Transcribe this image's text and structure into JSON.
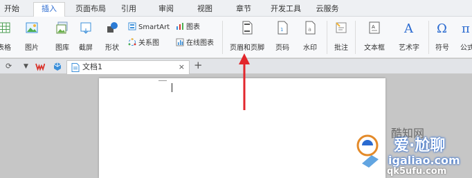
{
  "menu": {
    "tabs": [
      "开始",
      "插入",
      "页面布局",
      "引用",
      "审阅",
      "视图",
      "章节",
      "开发工具",
      "云服务"
    ],
    "active": "插入"
  },
  "ribbon": {
    "table_label": "表格",
    "picture_label": "图片",
    "gallery_label": "图库",
    "screenshot_label": "截屏",
    "shape_label": "形状",
    "smartart_label": "SmartArt",
    "chart_label": "图表",
    "relation_label": "关系图",
    "online_chart_label": "在线图表",
    "header_footer_label": "页眉和页脚",
    "page_number_label": "页码",
    "watermark_label": "水印",
    "comment_label": "批注",
    "textbox_label": "文本框",
    "wordart_label": "艺术字",
    "symbol_label": "符号",
    "formula_label": "公式"
  },
  "docbar": {
    "document_tab": "文档1",
    "close_glyph": "×",
    "new_tab_glyph": "+"
  },
  "watermark": {
    "line1": "爱·尬聊",
    "line2": "igaliao.com",
    "line3": "qk5ufu.com"
  },
  "colors": {
    "accent": "#2a6ad0",
    "arrow": "#e2262c",
    "wps_red": "#d9322a"
  }
}
